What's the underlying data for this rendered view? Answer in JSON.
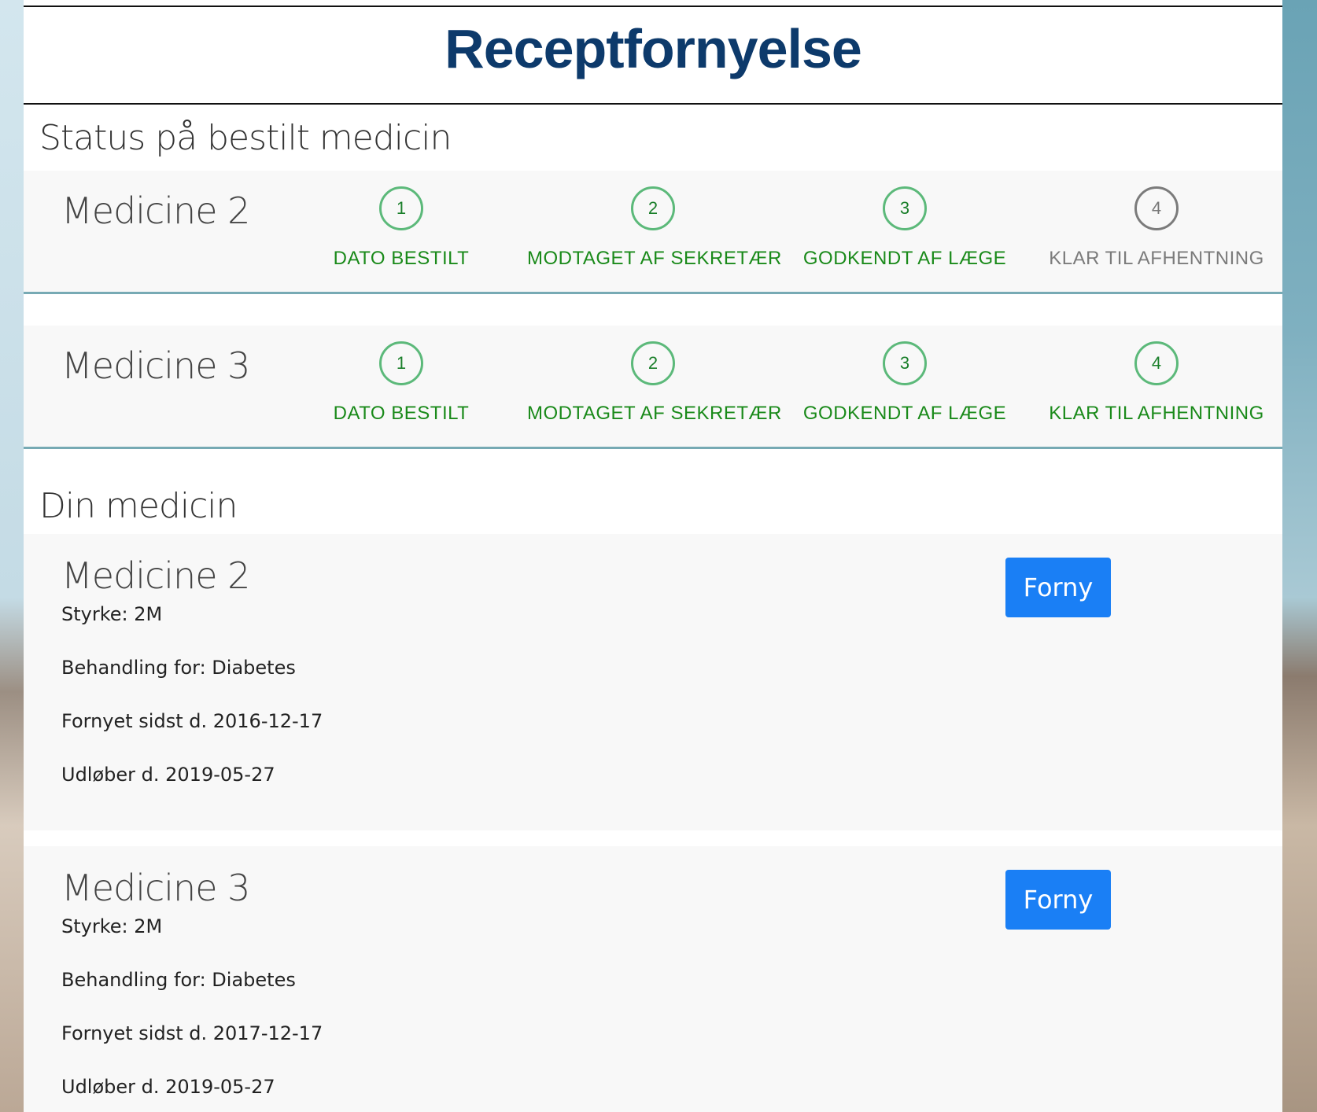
{
  "header": {
    "title": "Receptfornyelse"
  },
  "status_section": {
    "title": "Status på bestilt medicin",
    "orders": [
      {
        "name": "Medicine 2",
        "steps": [
          {
            "number": "1",
            "label": "DATO BESTILT",
            "state": "done"
          },
          {
            "number": "2",
            "label": "MODTAGET AF SEKRETÆR",
            "state": "done"
          },
          {
            "number": "3",
            "label": "GODKENDT AF LÆGE",
            "state": "done"
          },
          {
            "number": "4",
            "label": "KLAR TIL AFHENTNING",
            "state": "pending"
          }
        ]
      },
      {
        "name": "Medicine 3",
        "steps": [
          {
            "number": "1",
            "label": "DATO BESTILT",
            "state": "done"
          },
          {
            "number": "2",
            "label": "MODTAGET AF SEKRETÆR",
            "state": "done"
          },
          {
            "number": "3",
            "label": "GODKENDT AF LÆGE",
            "state": "done"
          },
          {
            "number": "4",
            "label": "KLAR TIL AFHENTNING",
            "state": "done"
          }
        ]
      }
    ]
  },
  "medicine_section": {
    "title": "Din medicin",
    "items": [
      {
        "name": "Medicine 2",
        "strength": "Styrke: 2M",
        "treatment": "Behandling for: Diabetes",
        "renewed": "Fornyet sidst d. 2016-12-17",
        "expires": "Udløber d. 2019-05-27",
        "button": "Forny"
      },
      {
        "name": "Medicine 3",
        "strength": "Styrke: 2M",
        "treatment": "Behandling for: Diabetes",
        "renewed": "Fornyet sidst d. 2017-12-17",
        "expires": "Udløber d. 2019-05-27",
        "button": "Forny"
      }
    ]
  },
  "colors": {
    "title": "#0d3a6b",
    "step_done": "#1a8a1a",
    "step_pending": "#7b7b7b",
    "button": "#1a7ff5",
    "row_border": "#77aab4"
  }
}
